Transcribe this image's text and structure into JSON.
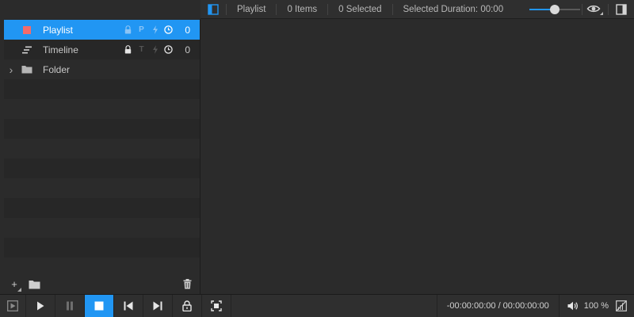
{
  "toolbar": {
    "playlist_label": "Playlist",
    "items_label": "0 Items",
    "selected_label": "0 Selected",
    "duration_label": "Selected Duration: 00:00",
    "zoom_level": 0.5
  },
  "tree": [
    {
      "label": "Playlist",
      "count": "0",
      "flag_p": "P",
      "selected": true,
      "icon": "playlist-color-swatch-icon",
      "icon_color": "#f36b6b"
    },
    {
      "label": "Timeline",
      "count": "0",
      "flag_t": "T",
      "selected": false,
      "icon": "timeline-icon"
    },
    {
      "label": "Folder",
      "expand": "›",
      "selected": false,
      "icon": "folder-icon"
    }
  ],
  "left_bottom": {
    "add_glyph": "+"
  },
  "transport": {
    "timecode": "-00:00:00:00 / 00:00:00:00",
    "volume": "100 %"
  },
  "colors": {
    "accent": "#2196f3",
    "playlist_swatch": "#f36b6b"
  }
}
